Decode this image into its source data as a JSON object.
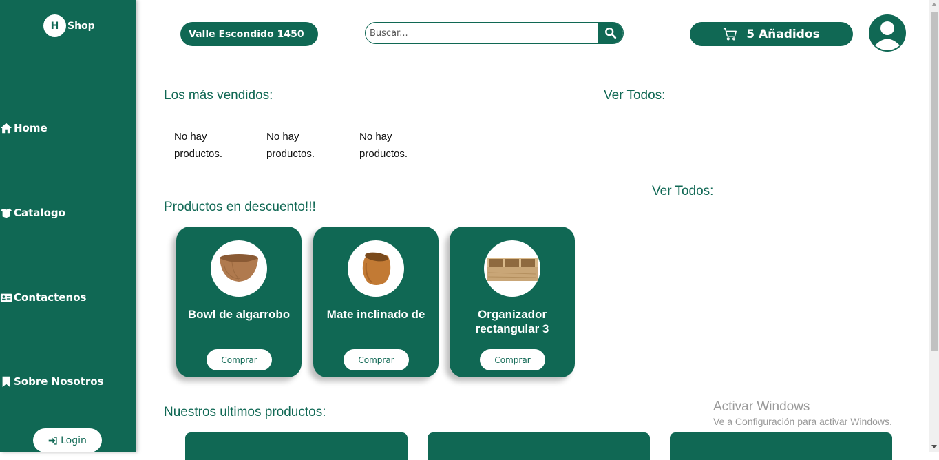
{
  "brand": {
    "logo_letter": "H",
    "name": "Shop"
  },
  "colors": {
    "primary": "#106854",
    "background": "#ffffff"
  },
  "sidebar": {
    "items": [
      {
        "label": "Home",
        "icon": "home-icon"
      },
      {
        "label": "Catalogo",
        "icon": "box-open-icon"
      },
      {
        "label": "Contactenos",
        "icon": "contact-card-icon"
      },
      {
        "label": "Sobre Nosotros",
        "icon": "bookmark-icon"
      }
    ],
    "login_label": "Login",
    "login_icon": "sign-in-icon"
  },
  "header": {
    "address": "Valle Escondido 1450",
    "search_placeholder": "Buscar...",
    "search_icon": "search-icon",
    "cart_label": "5 Añadidos",
    "cart_icon": "cart-icon",
    "avatar_icon": "user-avatar-icon"
  },
  "best_sellers": {
    "title": "Los más vendidos:",
    "see_all": "Ver Todos:",
    "empty_items": [
      "No hay productos.",
      "No hay productos.",
      "No hay productos."
    ]
  },
  "discounts": {
    "title": "Productos en descuento!!!",
    "see_all": "Ver Todos:",
    "products": [
      {
        "name": "Bowl de algarrobo",
        "button": "Comprar"
      },
      {
        "name": "Mate inclinado de",
        "button": "Comprar"
      },
      {
        "name": "Organizador rectangular 3",
        "button": "Comprar"
      }
    ]
  },
  "latest": {
    "title": "Nuestros ultimos productos:"
  },
  "watermark": {
    "line1": "Activar Windows",
    "line2": "Ve a Configuración para activar Windows."
  }
}
